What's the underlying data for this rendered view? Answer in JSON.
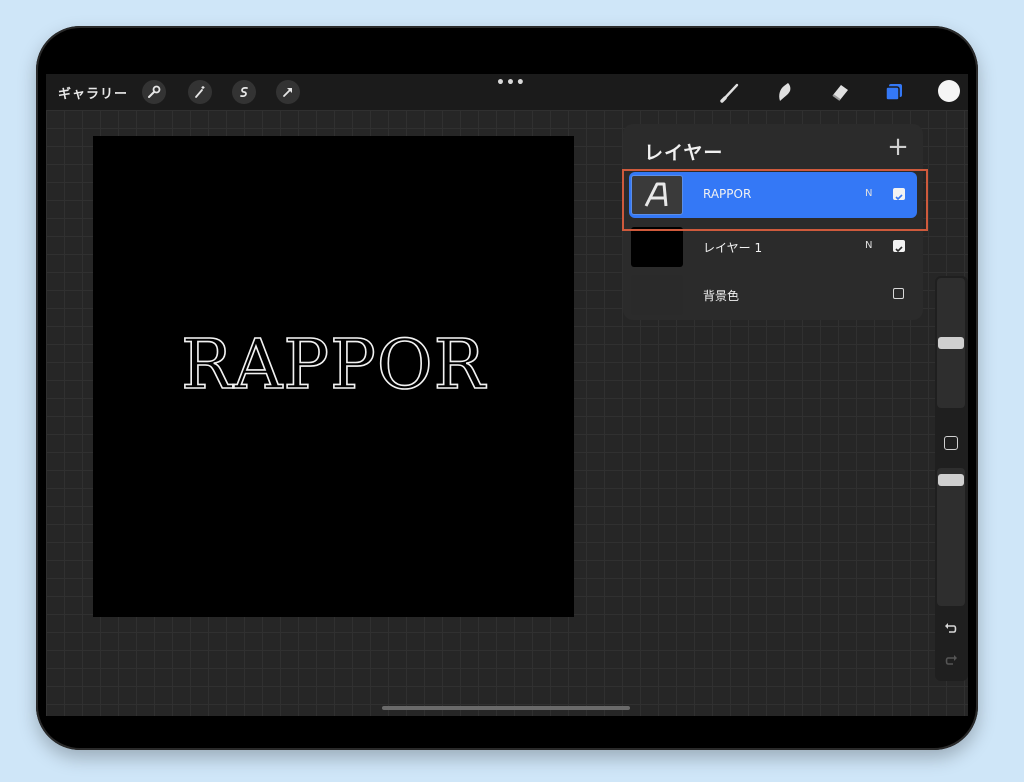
{
  "toolbar": {
    "gallery_label": "ギャラリー",
    "more_label": "•••",
    "left_tools": [
      "wrench-icon",
      "magic-wand-icon",
      "selection-icon",
      "transform-arrow-icon"
    ],
    "right_tools": [
      "brush-icon",
      "smudge-icon",
      "eraser-icon",
      "layers-icon"
    ],
    "active_tool": "layers-icon",
    "accent_color": "#3478f6",
    "current_color": "#f5f5f5"
  },
  "canvas": {
    "text": "RAPPOR",
    "background": "#000000"
  },
  "layers_panel": {
    "title": "レイヤー",
    "add_label": "+",
    "layers": [
      {
        "name": "RAPPOR",
        "blend": "N",
        "visible": true,
        "selected": true,
        "thumb": "A"
      },
      {
        "name": "レイヤー 1",
        "blend": "N",
        "visible": true,
        "selected": false
      },
      {
        "name": "背景色",
        "visible": false,
        "selected": false
      }
    ]
  },
  "sidebar": {
    "brush_size_level": 0.5,
    "opacity_level": 0.95
  }
}
